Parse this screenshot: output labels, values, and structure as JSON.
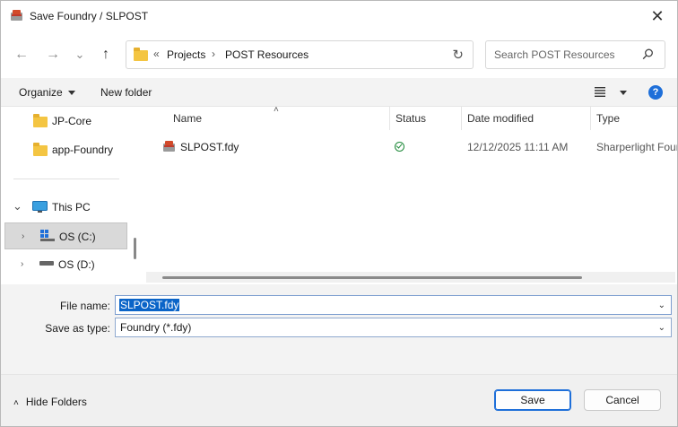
{
  "window": {
    "title": "Save Foundry / SLPOST",
    "close_glyph": "✕"
  },
  "navbar": {
    "back_glyph": "←",
    "forward_glyph": "→",
    "recent_glyph": "⌄",
    "up_glyph": "↑",
    "overflow_glyph": "«",
    "breadcrumbs": [
      "Projects",
      "POST Resources"
    ],
    "separator": "›",
    "refresh_glyph": "↻",
    "search_placeholder": "Search POST Resources"
  },
  "commandbar": {
    "organize_label": "Organize",
    "new_folder_label": "New folder",
    "help_label": "?"
  },
  "nav_pane": {
    "items": [
      {
        "label": "JP-Core",
        "icon": "folder-icon"
      },
      {
        "label": "app-Foundry",
        "icon": "folder-icon"
      },
      {
        "label": "This PC",
        "icon": "monitor-icon",
        "expander": "⌄"
      },
      {
        "label": "OS (C:)",
        "icon": "windows-drive-icon",
        "expander": "›",
        "selected": true
      },
      {
        "label": "OS (D:)",
        "icon": "drive-icon",
        "expander": "›"
      }
    ]
  },
  "file_list": {
    "columns": [
      "Name",
      "Status",
      "Date modified",
      "Type"
    ],
    "sort_glyph": "˄",
    "rows": [
      {
        "name": "SLPOST.fdy",
        "status": "ok",
        "date_modified": "12/12/2025 11:11 AM",
        "type": "Sharperlight Foun"
      }
    ]
  },
  "form": {
    "file_name_label": "File name:",
    "file_name_value": "SLPOST.fdy",
    "save_type_label": "Save as type:",
    "save_type_value": "Foundry (*.fdy)",
    "dropdown_glyph": "⌄"
  },
  "footer": {
    "hide_folders_glyph": "˄",
    "hide_folders_label": "Hide Folders",
    "save_label": "Save",
    "cancel_label": "Cancel"
  },
  "colors": {
    "accent": "#1e6fd9",
    "selection": "#0a64c8",
    "status_ok": "#1f8a3a",
    "folder": "#f4c542"
  }
}
